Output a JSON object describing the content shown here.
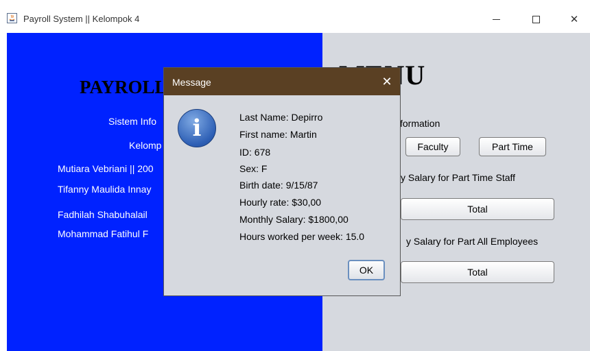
{
  "window": {
    "title": "Payroll System || Kelompok 4",
    "controls": {
      "minimize": "minimize",
      "maximize": "maximize",
      "close": "✕"
    }
  },
  "left_panel": {
    "title": "PAYROLL",
    "subtitle": "Sistem Info",
    "group": "Kelomp",
    "members": [
      "Mutiara Vebriani || 200",
      "Tifanny Maulida Innay",
      "Fadhilah Shabuhalail",
      "Mohammad Fatihul F"
    ]
  },
  "right_panel": {
    "title": "MENU",
    "info_label": "formation",
    "buttons": {
      "faculty": "Faculty",
      "part_time": "Part Time"
    },
    "salary_part_time_label": "y Salary for Part Time Staff",
    "total_button_1": "Total",
    "salary_all_label": "y Salary for Part All Employees",
    "total_button_2": "Total"
  },
  "dialog": {
    "title": "Message",
    "close": "✕",
    "icon": "info-icon",
    "lines": [
      "Last Name: Depirro",
      "First name: Martin",
      "ID: 678",
      "Sex: F",
      "Birth date: 9/15/87",
      "Hourly rate: $30,00",
      "Monthly Salary: $1800,00",
      "Hours worked per week: 15.0"
    ],
    "ok": "OK"
  },
  "colors": {
    "left_panel": "#0022ff",
    "right_panel": "#d6d9df",
    "dialog_title_bar": "#5a4023"
  }
}
